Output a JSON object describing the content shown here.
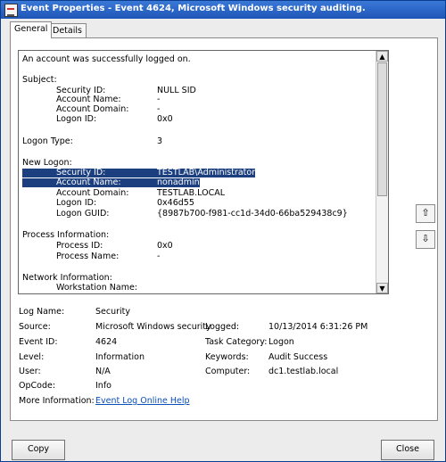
{
  "window": {
    "title": "Event Properties - Event 4624, Microsoft Windows security auditing."
  },
  "tabs": [
    {
      "label": "General",
      "active": true
    },
    {
      "label": "Details",
      "active": false
    }
  ],
  "description": {
    "intro": "An account was successfully logged on.",
    "subject": {
      "heading": "Subject:",
      "security_id_label": "Security ID:",
      "security_id": "NULL SID",
      "account_name_label": "Account Name:",
      "account_name": "-",
      "account_domain_label": "Account Domain:",
      "account_domain": "-",
      "logon_id_label": "Logon ID:",
      "logon_id": "0x0"
    },
    "logon_type_label": "Logon Type:",
    "logon_type": "3",
    "new_logon": {
      "heading": "New Logon:",
      "security_id_label": "Security ID:",
      "security_id": "TESTLAB\\Administrator",
      "account_name_label": "Account Name:",
      "account_name": "nonadmin",
      "account_domain_label": "Account Domain:",
      "account_domain": "TESTLAB.LOCAL",
      "logon_id_label": "Logon ID:",
      "logon_id": "0x46d55",
      "logon_guid_label": "Logon GUID:",
      "logon_guid": "{8987b700-f981-cc1d-34d0-66ba529438c9}"
    },
    "process": {
      "heading": "Process Information:",
      "process_id_label": "Process ID:",
      "process_id": "0x0",
      "process_name_label": "Process Name:",
      "process_name": "-"
    },
    "network": {
      "heading": "Network Information:",
      "workstation_name_label": "Workstation Name:"
    }
  },
  "fields": {
    "log_name_label": "Log Name:",
    "log_name": "Security",
    "source_label": "Source:",
    "source": "Microsoft Windows security",
    "logged_label": "Logged:",
    "logged": "10/13/2014 6:31:26 PM",
    "event_id_label": "Event ID:",
    "event_id": "4624",
    "task_category_label": "Task Category:",
    "task_category": "Logon",
    "level_label": "Level:",
    "level": "Information",
    "keywords_label": "Keywords:",
    "keywords": "Audit Success",
    "user_label": "User:",
    "user": "N/A",
    "computer_label": "Computer:",
    "computer": "dc1.testlab.local",
    "opcode_label": "OpCode:",
    "opcode": "Info",
    "more_info_label": "More Information:",
    "more_info_link": "Event Log Online Help"
  },
  "buttons": {
    "copy": "Copy",
    "close": "Close"
  },
  "icons": {
    "prev": "up-arrow-icon",
    "next": "down-arrow-icon"
  }
}
